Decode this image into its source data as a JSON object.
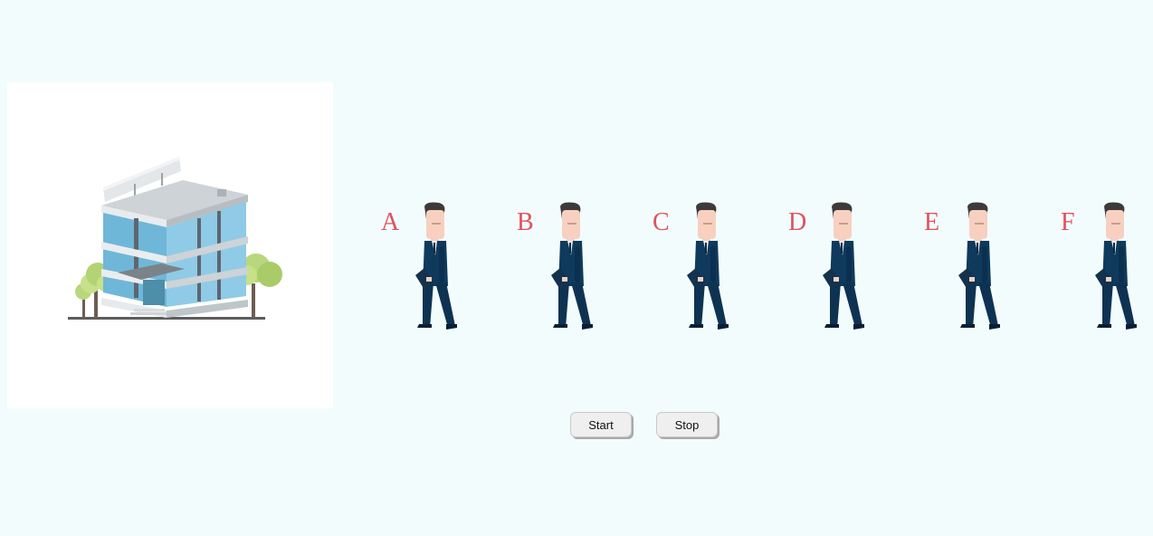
{
  "walkers": [
    {
      "letter": "A"
    },
    {
      "letter": "B"
    },
    {
      "letter": "C"
    },
    {
      "letter": "D"
    },
    {
      "letter": "E"
    },
    {
      "letter": "F"
    }
  ],
  "controls": {
    "start_label": "Start",
    "stop_label": "Stop"
  },
  "colors": {
    "background": "#f3fcfd",
    "letter": "#e0525c",
    "suit": "#0f3a5c"
  },
  "images": {
    "building": "office-building-illustration",
    "walker": "walking-businessman-with-briefcase"
  }
}
